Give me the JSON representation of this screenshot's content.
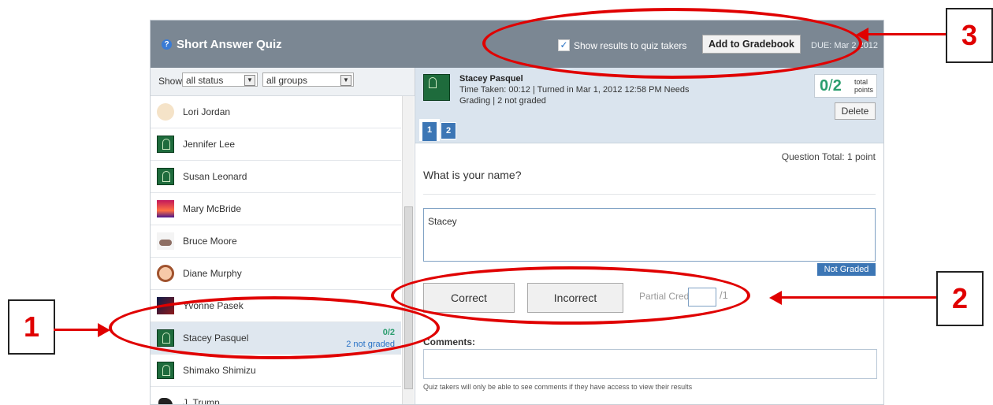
{
  "quiz": {
    "title": "Short Answer Quiz",
    "show_results_label": "Show results to quiz takers",
    "gradebook_label": "Add to Gradebook",
    "due": "DUE: Mar 2 2012"
  },
  "filters": {
    "show_label": "Show",
    "status": "all status",
    "groups": "all groups"
  },
  "students": [
    {
      "name": "Lori Jordan",
      "avatar": "cartoon-face"
    },
    {
      "name": "Jennifer Lee",
      "avatar": "default-avatar"
    },
    {
      "name": "Susan Leonard",
      "avatar": "default-avatar"
    },
    {
      "name": "Mary McBride",
      "avatar": "sunset-photo"
    },
    {
      "name": "Bruce Moore",
      "avatar": "shoes-photo"
    },
    {
      "name": "Diane Murphy",
      "avatar": "girl-face"
    },
    {
      "name": "Yvonne Pasek",
      "avatar": "night-photo"
    },
    {
      "name": "Stacey Pasquel",
      "avatar": "default-avatar",
      "score": "0/2",
      "status": "2 not graded",
      "selected": true
    },
    {
      "name": "Shimako Shimizu",
      "avatar": "default-avatar"
    },
    {
      "name": "J. Trump",
      "avatar": "panther-photo"
    }
  ],
  "detail": {
    "student_name": "Stacey Pasquel",
    "meta": "Time Taken: 00:12  |  Turned in Mar 1, 2012 12:58 PM Needs Grading  |  2 not graded",
    "score": "0",
    "total": "2",
    "total_points_label": "total points",
    "delete_label": "Delete",
    "tabs": [
      "1",
      "2"
    ],
    "question_total": "Question Total: 1 point",
    "question": "What is your name?",
    "answer": "Stacey",
    "not_graded": "Not Graded",
    "correct_label": "Correct",
    "incorrect_label": "Incorrect",
    "partial_label": "Partial Credit",
    "partial_den": "/1",
    "comments_label": "Comments:",
    "comments_note": "Quiz takers will only be able to see comments if they have access to view their results"
  },
  "callouts": [
    "1",
    "2",
    "3"
  ],
  "colors": {
    "annotation": "#e00000",
    "header": "#7b8793",
    "accent": "#3c76b5"
  }
}
